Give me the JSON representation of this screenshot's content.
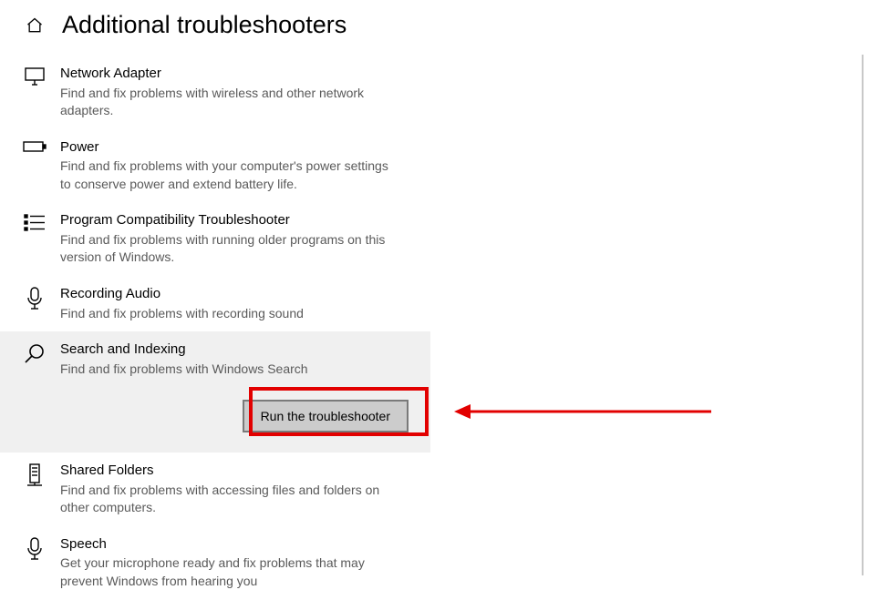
{
  "header": {
    "title": "Additional troubleshooters"
  },
  "items": [
    {
      "id": "network-adapter",
      "icon": "monitor-icon",
      "title": "Network Adapter",
      "desc": "Find and fix problems with wireless and other network adapters.",
      "selected": false
    },
    {
      "id": "power",
      "icon": "battery-icon",
      "title": "Power",
      "desc": "Find and fix problems with your computer's power settings to conserve power and extend battery life.",
      "selected": false
    },
    {
      "id": "program-compat",
      "icon": "list-icon",
      "title": "Program Compatibility Troubleshooter",
      "desc": "Find and fix problems with running older programs on this version of Windows.",
      "selected": false
    },
    {
      "id": "recording-audio",
      "icon": "microphone-icon",
      "title": "Recording Audio",
      "desc": "Find and fix problems with recording sound",
      "selected": false
    },
    {
      "id": "search-indexing",
      "icon": "search-icon",
      "title": "Search and Indexing",
      "desc": "Find and fix problems with Windows Search",
      "selected": true
    },
    {
      "id": "shared-folders",
      "icon": "server-icon",
      "title": "Shared Folders",
      "desc": "Find and fix problems with accessing files and folders on other computers.",
      "selected": false
    },
    {
      "id": "speech",
      "icon": "microphone-icon",
      "title": "Speech",
      "desc": "Get your microphone ready and fix problems that may prevent Windows from hearing you",
      "selected": false
    }
  ],
  "run_button_label": "Run the troubleshooter",
  "annotation": {
    "highlight_item": "search-indexing"
  }
}
